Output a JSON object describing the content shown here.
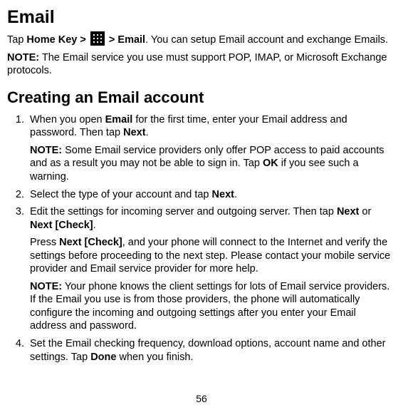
{
  "h1": "Email",
  "intro": {
    "p1_a": "Tap ",
    "p1_b": "Home Key > ",
    "p1_c": " > Email",
    "p1_d": ". You can setup Email account and exchange Emails.",
    "p2_a": "NOTE:",
    "p2_b": " The Email service you use must support POP, IMAP, or Microsoft Exchange protocols."
  },
  "h2": "Creating an Email account",
  "steps": {
    "s1": {
      "a": "When you open ",
      "b": "Email",
      "c": " for the first time, enter your Email address and password. Then tap ",
      "d": "Next",
      "e": ".",
      "note_a": "NOTE:",
      "note_b": " Some Email service providers only offer POP access to paid accounts and as a result you may not be able to sign in. Tap ",
      "note_c": "OK",
      "note_d": " if you see such a warning."
    },
    "s2": {
      "a": "Select the type of your account and tap ",
      "b": "Next",
      "c": "."
    },
    "s3": {
      "a": "Edit the settings for incoming server and outgoing server. Then tap ",
      "b": "Next",
      "c": " or ",
      "d": "Next [Check]",
      "e": ".",
      "p2_a": "Press ",
      "p2_b": "Next [Check]",
      "p2_c": ", and your phone will connect to the Internet and verify the settings before proceeding to the next step. Please contact your mobile service provider and Email service provider for more help.",
      "note_a": "NOTE:",
      "note_b": " Your phone knows the client settings for lots of Email service providers. If the Email you use is from those providers, the phone will automatically configure the incoming and outgoing settings after you enter your Email address and password."
    },
    "s4": {
      "a": "Set the Email checking frequency, download options, account name and other settings. Tap ",
      "b": "Done",
      "c": " when you finish."
    }
  },
  "page_number": "56"
}
